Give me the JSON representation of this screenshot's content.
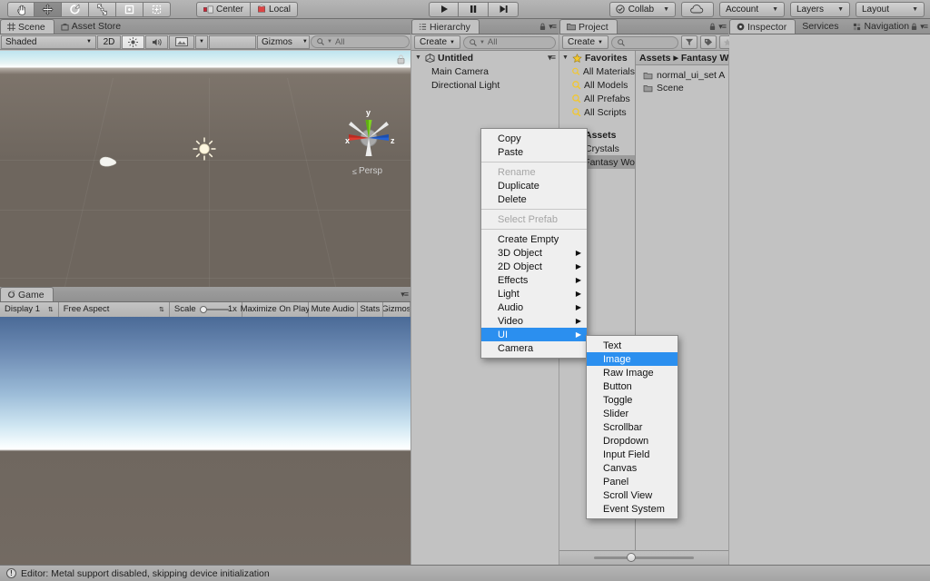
{
  "toolbar": {
    "tools": [
      {
        "name": "hand-tool",
        "icon": "hand",
        "active": false
      },
      {
        "name": "move-tool",
        "icon": "move",
        "active": true
      },
      {
        "name": "rotate-tool",
        "icon": "rotate",
        "active": false
      },
      {
        "name": "scale-tool",
        "icon": "scale",
        "active": false
      },
      {
        "name": "rect-tool",
        "icon": "rect",
        "active": false
      },
      {
        "name": "transform-tool",
        "icon": "transform",
        "active": false
      }
    ],
    "pivot_mode": "Center",
    "pivot_rotation": "Local",
    "play": "play",
    "pause": "pause",
    "step": "step",
    "collab_label": "Collab",
    "cloud_label": "",
    "account_label": "Account",
    "layers_label": "Layers",
    "layout_label": "Layout"
  },
  "scene": {
    "tabs": [
      {
        "label": "Scene",
        "icon": "grid-icon",
        "active": true
      },
      {
        "label": "Asset Store",
        "icon": "store-icon",
        "active": false
      }
    ],
    "shading_mode": "Shaded",
    "toggle_2d": "2D",
    "gizmos_label": "Gizmos",
    "search_placeholder": "All",
    "gizmo_axes": {
      "x": "x",
      "y": "y",
      "z": "z"
    },
    "projection": "Persp"
  },
  "game": {
    "tabs": [
      {
        "label": "Game",
        "icon": "gamepad-icon",
        "active": true
      }
    ],
    "display": "Display 1",
    "aspect": "Free Aspect",
    "scale_label": "Scale",
    "scale_value": "1x",
    "maximize_on_play": "Maximize On Play",
    "mute_audio": "Mute Audio",
    "stats": "Stats",
    "gizmos": "Gizmos"
  },
  "hierarchy": {
    "tabs": [
      {
        "label": "Hierarchy",
        "icon": "hierarchy-icon",
        "active": true
      }
    ],
    "create_label": "Create",
    "search_placeholder": "All",
    "scene_name": "Untitled",
    "objects": [
      {
        "label": "Main Camera"
      },
      {
        "label": "Directional Light"
      }
    ]
  },
  "project": {
    "tabs": [
      {
        "label": "Project",
        "icon": "folder-icon",
        "active": true
      }
    ],
    "create_label": "Create",
    "search_placeholder": "",
    "favorites_label": "Favorites",
    "favorites": [
      {
        "label": "All Materials"
      },
      {
        "label": "All Models"
      },
      {
        "label": "All Prefabs"
      },
      {
        "label": "All Scripts"
      }
    ],
    "assets_label": "Assets",
    "assets_tree": [
      {
        "label": "Crystals",
        "selected": false
      },
      {
        "label": "Fantasy Wo",
        "selected": true
      }
    ],
    "breadcrumb": [
      "Assets",
      "Fantasy Wo"
    ],
    "contents": [
      {
        "label": "normal_ui_set A"
      },
      {
        "label": "Scene"
      }
    ]
  },
  "inspector": {
    "tabs": [
      {
        "label": "Inspector",
        "icon": "info-icon",
        "active": true
      },
      {
        "label": "Services",
        "icon": "",
        "active": false
      },
      {
        "label": "Navigation",
        "icon": "nav-icon",
        "active": false
      }
    ]
  },
  "context_menu": {
    "groups": [
      [
        {
          "label": "Copy",
          "disabled": false,
          "submenu": false,
          "highlighted": false
        },
        {
          "label": "Paste",
          "disabled": false,
          "submenu": false,
          "highlighted": false
        }
      ],
      [
        {
          "label": "Rename",
          "disabled": true,
          "submenu": false,
          "highlighted": false
        },
        {
          "label": "Duplicate",
          "disabled": false,
          "submenu": false,
          "highlighted": false
        },
        {
          "label": "Delete",
          "disabled": false,
          "submenu": false,
          "highlighted": false
        }
      ],
      [
        {
          "label": "Select Prefab",
          "disabled": true,
          "submenu": false,
          "highlighted": false
        }
      ],
      [
        {
          "label": "Create Empty",
          "disabled": false,
          "submenu": false,
          "highlighted": false
        },
        {
          "label": "3D Object",
          "disabled": false,
          "submenu": true,
          "highlighted": false
        },
        {
          "label": "2D Object",
          "disabled": false,
          "submenu": true,
          "highlighted": false
        },
        {
          "label": "Effects",
          "disabled": false,
          "submenu": true,
          "highlighted": false
        },
        {
          "label": "Light",
          "disabled": false,
          "submenu": true,
          "highlighted": false
        },
        {
          "label": "Audio",
          "disabled": false,
          "submenu": true,
          "highlighted": false
        },
        {
          "label": "Video",
          "disabled": false,
          "submenu": true,
          "highlighted": false
        },
        {
          "label": "UI",
          "disabled": false,
          "submenu": true,
          "highlighted": true
        },
        {
          "label": "Camera",
          "disabled": false,
          "submenu": false,
          "highlighted": false
        }
      ]
    ]
  },
  "ui_submenu": {
    "items": [
      {
        "label": "Text",
        "highlighted": false
      },
      {
        "label": "Image",
        "highlighted": true
      },
      {
        "label": "Raw Image",
        "highlighted": false
      },
      {
        "label": "Button",
        "highlighted": false
      },
      {
        "label": "Toggle",
        "highlighted": false
      },
      {
        "label": "Slider",
        "highlighted": false
      },
      {
        "label": "Scrollbar",
        "highlighted": false
      },
      {
        "label": "Dropdown",
        "highlighted": false
      },
      {
        "label": "Input Field",
        "highlighted": false
      },
      {
        "label": "Canvas",
        "highlighted": false
      },
      {
        "label": "Panel",
        "highlighted": false
      },
      {
        "label": "Scroll View",
        "highlighted": false
      },
      {
        "label": "Event System",
        "highlighted": false
      }
    ]
  },
  "statusbar": {
    "message": "Editor: Metal support disabled, skipping device initialization"
  },
  "colors": {
    "highlight": "#2b8fef",
    "panel_bg": "#c2c2c2",
    "chrome": "#a3a3a3"
  }
}
